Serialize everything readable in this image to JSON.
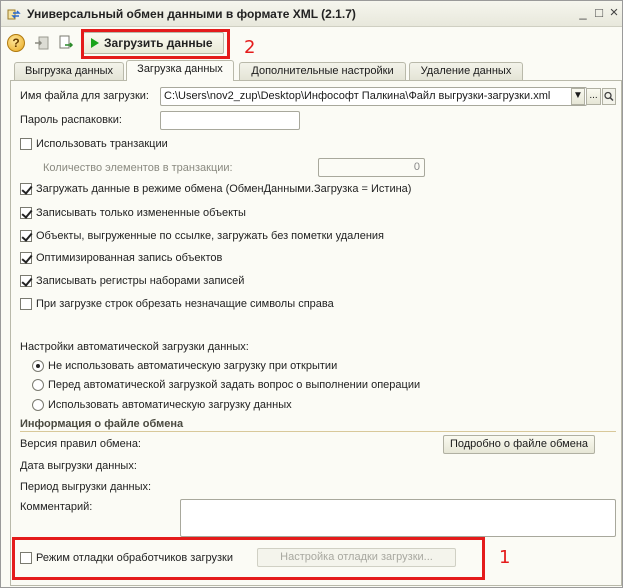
{
  "window": {
    "title": "Универсальный обмен данными в формате XML (2.1.7)",
    "min_glyph": "_",
    "max_glyph": "□",
    "close_glyph": "×"
  },
  "toolbar": {
    "help_glyph": "?",
    "load_label": "Загрузить данные"
  },
  "annotations": {
    "box_label_top": "2",
    "box_label_bottom": "1",
    "color": "#e41b1b"
  },
  "tabs": [
    {
      "label": "Выгрузка данных",
      "active": false
    },
    {
      "label": "Загрузка данных",
      "active": true
    },
    {
      "label": "Дополнительные настройки",
      "active": false
    },
    {
      "label": "Удаление данных",
      "active": false
    }
  ],
  "form": {
    "file_label": "Имя файла для загрузки:",
    "file_value": "C:\\Users\\nov2_zup\\Desktop\\Инфософт Палкина\\Файл выгрузки-загрузки.xml",
    "dropdown_glyph": "▼",
    "ellipsis_glyph": "...",
    "password_label": "Пароль распаковки:",
    "password_value": "",
    "use_transactions": {
      "label": "Использовать транзакции",
      "checked": false
    },
    "tx_count_label": "Количество элементов в транзакции:",
    "tx_count_value": "0",
    "options": [
      {
        "label": "Загружать данные в режиме обмена (ОбменДанными.Загрузка = Истина)",
        "checked": true
      },
      {
        "label": "Записывать только измененные объекты",
        "checked": true
      },
      {
        "label": "Объекты, выгруженные по ссылке, загружать без пометки удаления",
        "checked": true
      },
      {
        "label": "Оптимизированная запись объектов",
        "checked": true
      },
      {
        "label": "Записывать регистры наборами записей",
        "checked": true
      },
      {
        "label": "При загрузке строк обрезать незначащие символы справа",
        "checked": false
      }
    ],
    "auto_label": "Настройки автоматической загрузки данных:",
    "auto_options": [
      {
        "label": "Не использовать автоматическую загрузку при открытии",
        "selected": true
      },
      {
        "label": "Перед автоматической загрузкой задать вопрос о выполнении операции",
        "selected": false
      },
      {
        "label": "Использовать автоматическую загрузку данных",
        "selected": false
      }
    ],
    "info_title": "Информация о файле обмена",
    "rules_version_label": "Версия правил обмена:",
    "details_button": "Подробно о файле обмена",
    "export_date_label": "Дата выгрузки данных:",
    "export_period_label": "Период выгрузки данных:",
    "comment_label": "Комментарий:",
    "debug_mode": {
      "label": "Режим отладки обработчиков загрузки",
      "checked": false
    },
    "debug_settings_button": "Настройка отладки загрузки..."
  }
}
